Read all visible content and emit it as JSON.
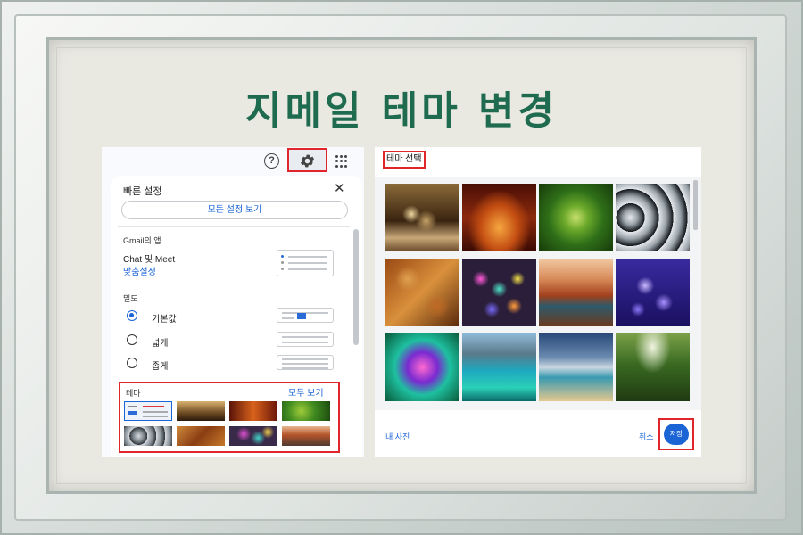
{
  "title": "지메일 테마 변경",
  "left": {
    "quick_settings_title": "빠른 설정",
    "see_all_settings": "모든 설정 보기",
    "apps_section": "Gmail의 앱",
    "chat_meet": "Chat 및 Meet",
    "customize": "맞춤설정",
    "density_section": "밀도",
    "density_options": [
      {
        "label": "기본값",
        "selected": true
      },
      {
        "label": "넓게",
        "selected": false
      },
      {
        "label": "좁게",
        "selected": false
      }
    ],
    "theme_section": "테마",
    "see_all": "모두 보기",
    "help_glyph": "?",
    "close_glyph": "✕"
  },
  "right": {
    "title": "테마 선택",
    "my_photos": "내 사진",
    "cancel": "취소",
    "save": "저장"
  },
  "colors": {
    "title_green": "#1f6b50",
    "highlight_red": "#e0262b",
    "link_blue": "#1a64d6"
  },
  "theme_thumbnails": [
    "default",
    "chess",
    "canyon",
    "leaf",
    "pipes",
    "autumn-leaves",
    "bokeh",
    "desert-river"
  ],
  "theme_tiles": [
    "chess",
    "canyon",
    "leaf",
    "pipes",
    "autumn-leaves",
    "bokeh",
    "desert-river",
    "jellyfish",
    "abstract-color",
    "lake-water",
    "beach",
    "forest"
  ]
}
